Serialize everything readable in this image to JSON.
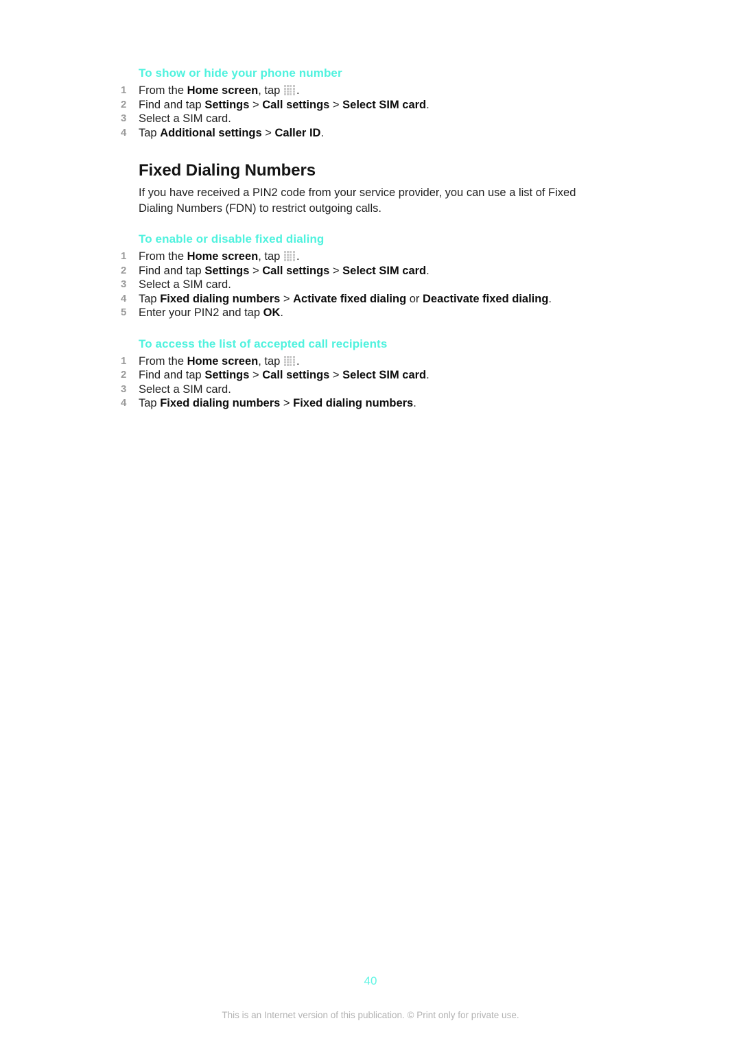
{
  "document": {
    "page_number": "40",
    "footer_note": "This is an Internet version of this publication. © Print only for private use.",
    "accent_color": "#4ff2de",
    "icon_name": "app-drawer-icon"
  },
  "sections": {
    "show_hide_number": {
      "heading": "To show or hide your phone number",
      "steps": [
        {
          "prefix": "From the ",
          "bold1": "Home screen",
          "mid": ", tap ",
          "icon": "app-drawer-icon",
          "suffix": "."
        },
        {
          "prefix": "Find and tap ",
          "bold1": "Settings",
          "sep1": " > ",
          "bold2": "Call settings",
          "sep2": " > ",
          "bold3": "Select SIM card",
          "suffix": "."
        },
        {
          "prefix": "Select a SIM card.",
          "suffix": ""
        },
        {
          "prefix": "Tap ",
          "bold1": "Additional settings",
          "sep1": " > ",
          "bold2": "Caller ID",
          "suffix": "."
        }
      ]
    },
    "fixed_dialing": {
      "title": "Fixed Dialing Numbers",
      "paragraph": "If you have received a PIN2 code from your service provider, you can use a list of Fixed Dialing Numbers (FDN) to restrict outgoing calls."
    },
    "enable_disable": {
      "heading": "To enable or disable fixed dialing",
      "steps": [
        {
          "prefix": "From the ",
          "bold1": "Home screen",
          "mid": ", tap ",
          "icon": "app-drawer-icon",
          "suffix": "."
        },
        {
          "prefix": "Find and tap ",
          "bold1": "Settings",
          "sep1": " > ",
          "bold2": "Call settings",
          "sep2": " > ",
          "bold3": "Select SIM card",
          "suffix": "."
        },
        {
          "prefix": "Select a SIM card.",
          "suffix": ""
        },
        {
          "prefix": "Tap ",
          "bold1": "Fixed dialing numbers",
          "sep1": " > ",
          "bold2": "Activate fixed dialing",
          "sep2": " or ",
          "bold3": "Deactivate fixed dialing",
          "suffix": "."
        },
        {
          "prefix": "Enter your PIN2 and tap ",
          "bold1": "OK",
          "suffix": "."
        }
      ]
    },
    "access_list": {
      "heading": "To access the list of accepted call recipients",
      "steps": [
        {
          "prefix": "From the ",
          "bold1": "Home screen",
          "mid": ", tap ",
          "icon": "app-drawer-icon",
          "suffix": "."
        },
        {
          "prefix": "Find and tap ",
          "bold1": "Settings",
          "sep1": " > ",
          "bold2": "Call settings",
          "sep2": " > ",
          "bold3": "Select SIM card",
          "suffix": "."
        },
        {
          "prefix": "Select a SIM card.",
          "suffix": ""
        },
        {
          "prefix": "Tap ",
          "bold1": "Fixed dialing numbers",
          "sep1": " > ",
          "bold2": "Fixed dialing numbers",
          "suffix": "."
        }
      ]
    }
  }
}
